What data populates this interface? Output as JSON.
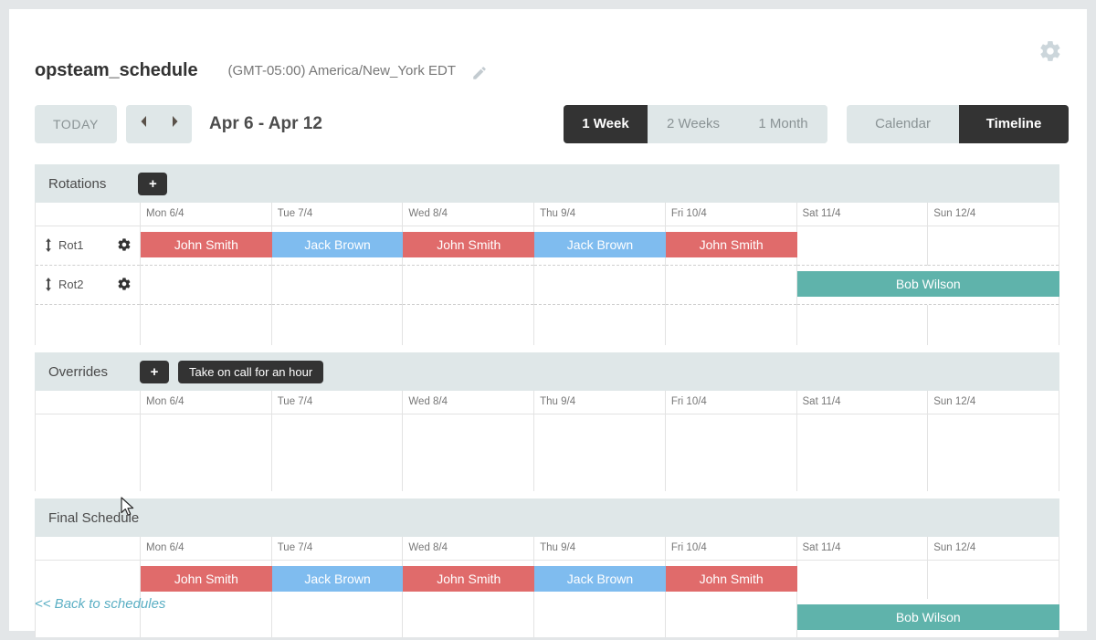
{
  "header": {
    "schedule_name": "opsteam_schedule",
    "timezone": "(GMT-05:00) America/New_York EDT",
    "edit_icon": "pencil-icon",
    "settings_icon": "gear-icon"
  },
  "toolbar": {
    "today_label": "TODAY",
    "prev_label": "‹",
    "next_label": "›",
    "date_range": "Apr 6 - Apr 12",
    "span_options": [
      {
        "label": "1 Week",
        "active": true
      },
      {
        "label": "2 Weeks",
        "active": false
      },
      {
        "label": "1 Month",
        "active": false
      }
    ],
    "view_options": [
      {
        "label": "Calendar",
        "active": false
      },
      {
        "label": "Timeline",
        "active": true
      }
    ]
  },
  "days": [
    "Mon 6/4",
    "Tue 7/4",
    "Wed 8/4",
    "Thu 9/4",
    "Fri 10/4",
    "Sat 11/4",
    "Sun 12/4"
  ],
  "sections": {
    "rotations": {
      "title": "Rotations",
      "add_label": "+",
      "rows": [
        {
          "name": "Rot1",
          "handle_icon": "drag-vertical-icon",
          "cog_icon": "gear-icon",
          "entries": [
            {
              "day": 0,
              "span": 1,
              "label": "John Smith",
              "color": "red"
            },
            {
              "day": 1,
              "span": 1,
              "label": "Jack Brown",
              "color": "blue"
            },
            {
              "day": 2,
              "span": 1,
              "label": "John Smith",
              "color": "red"
            },
            {
              "day": 3,
              "span": 1,
              "label": "Jack Brown",
              "color": "blue"
            },
            {
              "day": 4,
              "span": 1,
              "label": "John Smith",
              "color": "red"
            }
          ]
        },
        {
          "name": "Rot2",
          "handle_icon": "drag-vertical-icon",
          "cog_icon": "gear-icon",
          "entries": [
            {
              "day": 5,
              "span": 2,
              "label": "Bob Wilson",
              "color": "green"
            }
          ]
        }
      ]
    },
    "overrides": {
      "title": "Overrides",
      "add_label": "+",
      "action_label": "Take on call for an hour",
      "rows": [
        {
          "name": "",
          "entries": []
        },
        {
          "name": "",
          "entries": []
        }
      ]
    },
    "final_schedule": {
      "title": "Final Schedule",
      "rows": [
        {
          "name": "",
          "entries": [
            {
              "day": 0,
              "span": 1,
              "label": "John Smith",
              "color": "red"
            },
            {
              "day": 1,
              "span": 1,
              "label": "Jack Brown",
              "color": "blue"
            },
            {
              "day": 2,
              "span": 1,
              "label": "John Smith",
              "color": "red"
            },
            {
              "day": 3,
              "span": 1,
              "label": "Jack Brown",
              "color": "blue"
            },
            {
              "day": 4,
              "span": 1,
              "label": "John Smith",
              "color": "red"
            }
          ]
        },
        {
          "name": "",
          "entries": [
            {
              "day": 5,
              "span": 2,
              "label": "Bob Wilson",
              "color": "green"
            }
          ]
        }
      ]
    }
  },
  "footer": {
    "back_link": "<< Back to schedules"
  },
  "colors": {
    "red": "#e06b6b",
    "blue": "#7fbcef",
    "green": "#5fb3ab",
    "dark": "#333333",
    "panel": "#dfe7e8",
    "link": "#5bafc4",
    "page_bg": "#e3e6e8"
  }
}
